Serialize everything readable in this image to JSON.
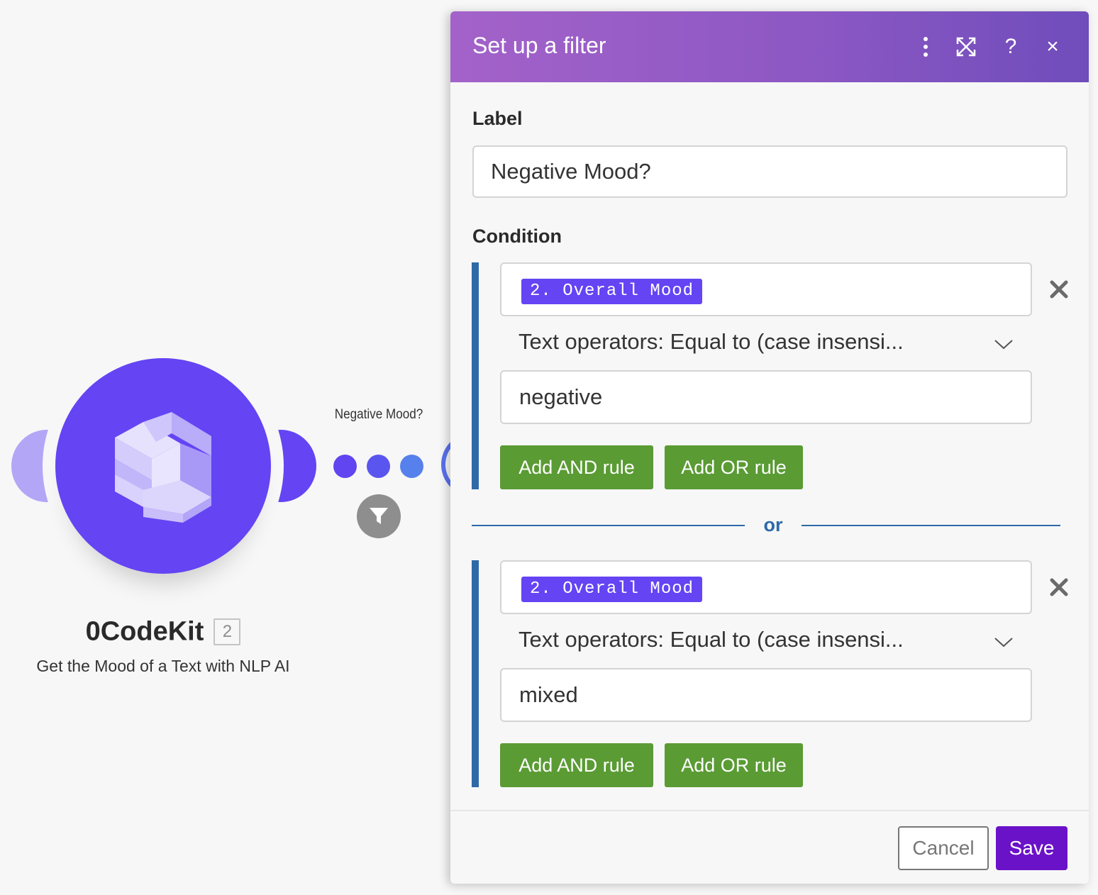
{
  "scenario": {
    "module": {
      "name": "0CodeKit",
      "badge": "2",
      "description": "Get the Mood of a Text with NLP AI",
      "icon": "0codekit-logo-icon"
    },
    "route": {
      "label": "Negative Mood?",
      "filter_icon": "filter-icon"
    }
  },
  "dialog": {
    "title": "Set up a filter",
    "header_icons": [
      "more-vertical-icon",
      "expand-icon",
      "help-icon",
      "close-icon"
    ],
    "help_glyph": "?",
    "close_glyph": "×",
    "label_heading": "Label",
    "label_value": "Negative Mood?",
    "condition_heading": "Condition",
    "groups": [
      {
        "field_pill": "2. Overall Mood",
        "operator": "Text operators: Equal to (case insensi...",
        "value": "negative",
        "add_and": "Add AND rule",
        "add_or": "Add OR rule"
      },
      {
        "field_pill": "2. Overall Mood",
        "operator": "Text operators: Equal to (case insensi...",
        "value": "mixed",
        "add_and": "Add AND rule",
        "add_or": "Add OR rule"
      }
    ],
    "separator": "or",
    "footer": {
      "cancel": "Cancel",
      "save": "Save"
    }
  },
  "colors": {
    "module_purple": "#6444f3",
    "header_gradient_start": "#a362c9",
    "header_gradient_end": "#6f4dbb",
    "rule_button_green": "#5a9b34",
    "condition_bar_blue": "#2e69a8",
    "save_purple": "#6a12c8"
  }
}
